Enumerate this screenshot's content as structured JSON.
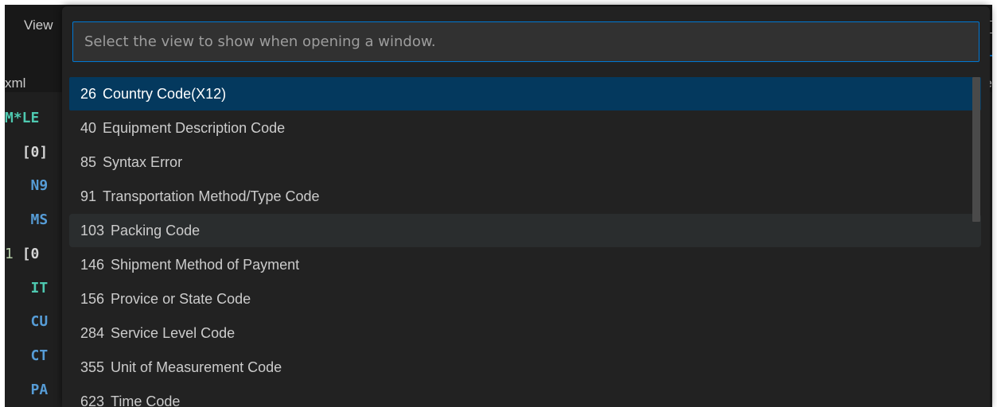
{
  "menu": {
    "view_label": "View"
  },
  "tab": {
    "left_label": "xml",
    "right_label": "e"
  },
  "editor": {
    "lines": [
      {
        "gutter": "",
        "text": "M*LE"
      },
      {
        "gutter": "",
        "text": "[0]"
      },
      {
        "gutter": "",
        "text": "N9"
      },
      {
        "gutter": "",
        "text": "MS"
      },
      {
        "gutter": "1",
        "text": "[0"
      },
      {
        "gutter": "",
        "text": "IT"
      },
      {
        "gutter": "",
        "text": "CU"
      },
      {
        "gutter": "",
        "text": "CT"
      },
      {
        "gutter": "",
        "text": "PA"
      }
    ]
  },
  "quickpick": {
    "placeholder": "Select the view to show when opening a window.",
    "value": "",
    "items": [
      {
        "code": "26",
        "label": "Country Code(X12)",
        "state": "selected"
      },
      {
        "code": "40",
        "label": "Equipment Description Code",
        "state": "normal"
      },
      {
        "code": "85",
        "label": "Syntax Error",
        "state": "normal"
      },
      {
        "code": "91",
        "label": "Transportation Method/Type Code",
        "state": "normal"
      },
      {
        "code": "103",
        "label": "Packing Code",
        "state": "hovered"
      },
      {
        "code": "146",
        "label": "Shipment Method of Payment",
        "state": "normal"
      },
      {
        "code": "156",
        "label": "Provice or State Code",
        "state": "normal"
      },
      {
        "code": "284",
        "label": "Service Level Code",
        "state": "normal"
      },
      {
        "code": "355",
        "label": "Unit of Measurement Code",
        "state": "normal"
      },
      {
        "code": "623",
        "label": "Time Code",
        "state": "normal"
      }
    ]
  },
  "colors": {
    "accent": "#0078d4",
    "selection": "#04395e",
    "hover": "#2a2d2e"
  }
}
